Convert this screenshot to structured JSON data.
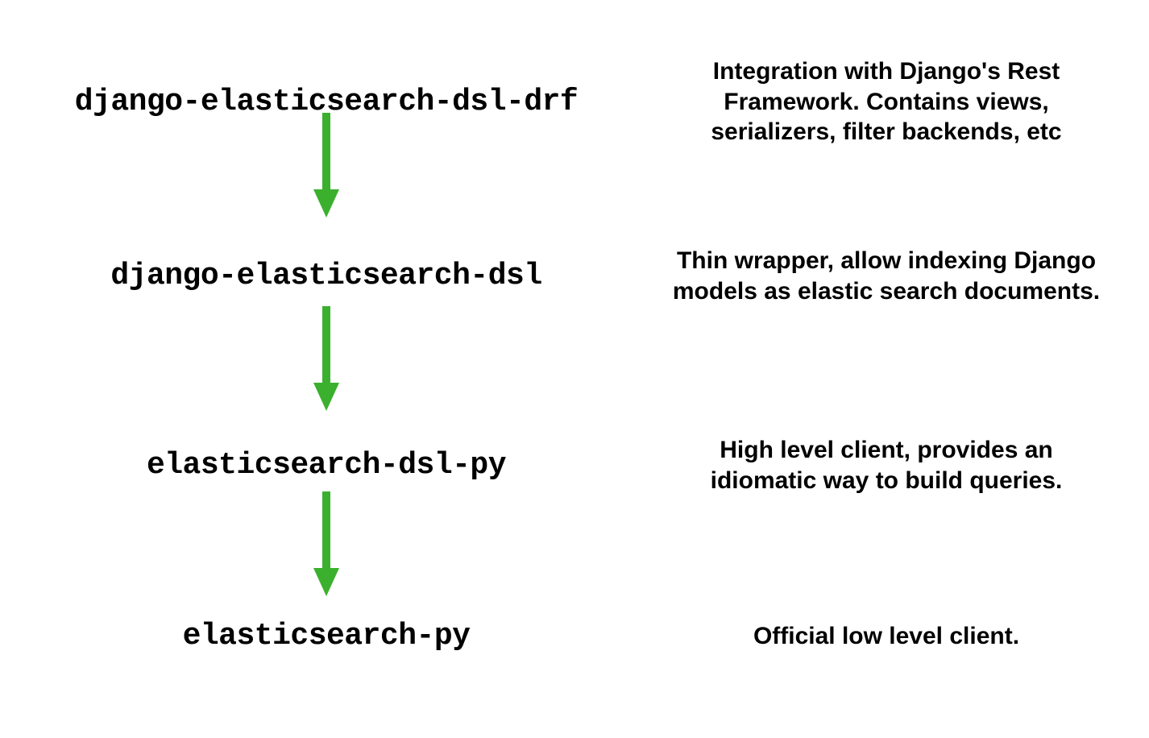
{
  "layers": [
    {
      "name": "django-elasticsearch-dsl-drf",
      "description": "Integration with Django's Rest Framework. Contains views, serializers, filter backends, etc"
    },
    {
      "name": "django-elasticsearch-dsl",
      "description": "Thin wrapper, allow indexing Django models as elastic search documents."
    },
    {
      "name": "elasticsearch-dsl-py",
      "description": "High level client, provides an idiomatic way to build queries."
    },
    {
      "name": "elasticsearch-py",
      "description": "Official low level client."
    }
  ],
  "arrow_color": "#3BB02E"
}
